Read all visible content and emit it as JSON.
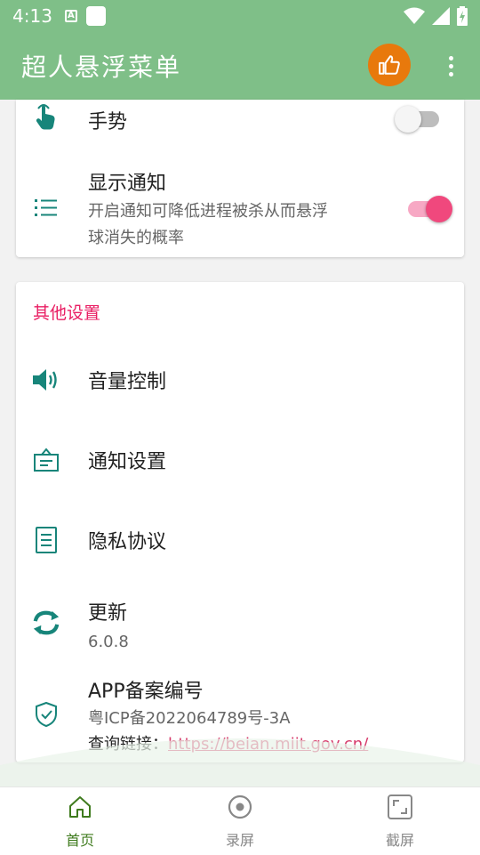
{
  "status_bar": {
    "time": "4:13"
  },
  "app_bar": {
    "title": "超人悬浮菜单"
  },
  "card1": {
    "gesture": {
      "title": "手势",
      "enabled": false
    },
    "notification": {
      "title": "显示通知",
      "subtitle_line1": "开启通知可降低进程被杀从而悬浮",
      "subtitle_line2": "球消失的概率",
      "enabled": true
    }
  },
  "card2": {
    "section_title": "其他设置",
    "volume": {
      "title": "音量控制"
    },
    "notify_settings": {
      "title": "通知设置"
    },
    "privacy": {
      "title": "隐私协议"
    },
    "update": {
      "title": "更新",
      "version": "6.0.8"
    },
    "icp": {
      "title": "APP备案编号",
      "number": "粤ICP备2022064789号-3A",
      "query_label": "查询链接：",
      "query_link": "https://beian.miit.gov.cn/"
    }
  },
  "bottom_nav": {
    "items": [
      {
        "label": "首页",
        "active": true
      },
      {
        "label": "录屏",
        "active": false
      },
      {
        "label": "截屏",
        "active": false
      }
    ]
  },
  "colors": {
    "primary": "#7fbf88",
    "accent_orange": "#e8790c",
    "toggle_on": "#f0487d",
    "section_pink": "#e91e63",
    "icon_teal": "#17857a",
    "nav_active": "#3f7b1e"
  }
}
